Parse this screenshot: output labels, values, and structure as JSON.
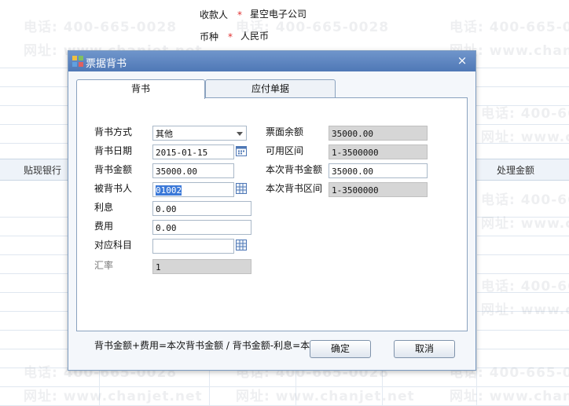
{
  "background": {
    "payee_label": "收款人",
    "payee_value": "星空电子公司",
    "currency_label": "币种",
    "currency_value": "人民币",
    "required_mark": "*",
    "columns": [
      "贴现银行",
      "处理金额"
    ],
    "watermark_phone": "电话: 400-665-0028",
    "watermark_url": "网址: www.chanjet.net"
  },
  "dialog": {
    "title": "票据背书",
    "close": "×",
    "tabs": [
      {
        "label": "背书",
        "active": true
      },
      {
        "label": "应付单据",
        "active": false
      }
    ],
    "left_fields": {
      "method": {
        "label": "背书方式",
        "value": "其他"
      },
      "date": {
        "label": "背书日期",
        "value": "2015-01-15"
      },
      "amount": {
        "label": "背书金额",
        "value": "35000.00"
      },
      "endorsee": {
        "label": "被背书人",
        "value": "01002"
      },
      "interest": {
        "label": "利息",
        "value": "0.00"
      },
      "fee": {
        "label": "费用",
        "value": "0.00"
      },
      "account": {
        "label": "对应科目",
        "value": ""
      },
      "rate": {
        "label": "汇率",
        "value": "1"
      }
    },
    "right_fields": {
      "face_balance": {
        "label": "票面余额",
        "value": "35000.00"
      },
      "available_range": {
        "label": "可用区间",
        "value": "1-3500000"
      },
      "current_amount": {
        "label": "本次背书金额",
        "value": "35000.00"
      },
      "current_range": {
        "label": "本次背书区间",
        "value": "1-3500000"
      }
    },
    "formula": "背书金额+费用=本次背书金额  /  背书金额-利息=本次背书金额",
    "buttons": {
      "ok": "确定",
      "cancel": "取消"
    }
  },
  "colors": {
    "title_bar": "#5a82bf",
    "required": "#e03030",
    "selection": "#3a78d8"
  }
}
